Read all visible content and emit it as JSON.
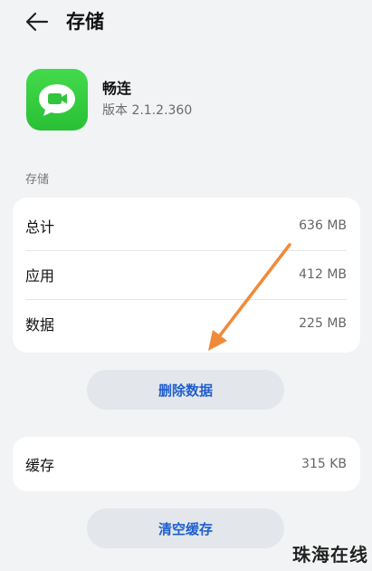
{
  "header": {
    "title": "存储",
    "back_icon": "arrow-left-icon"
  },
  "app": {
    "name": "畅连",
    "version": "版本 2.1.2.360",
    "icon": "video-call-icon",
    "icon_color": "#35c93f"
  },
  "storage": {
    "section_label": "存储",
    "rows": [
      {
        "label": "总计",
        "value": "636 MB"
      },
      {
        "label": "应用",
        "value": "412 MB"
      },
      {
        "label": "数据",
        "value": "225 MB"
      }
    ]
  },
  "actions": {
    "delete_data": "删除数据",
    "clear_cache": "清空缓存",
    "accent_color": "#1f5fcf"
  },
  "cache": {
    "label": "缓存",
    "value": "315 KB"
  },
  "annotation": {
    "arrow_color": "#f08a3a"
  },
  "watermark": {
    "text": "珠海在线"
  }
}
